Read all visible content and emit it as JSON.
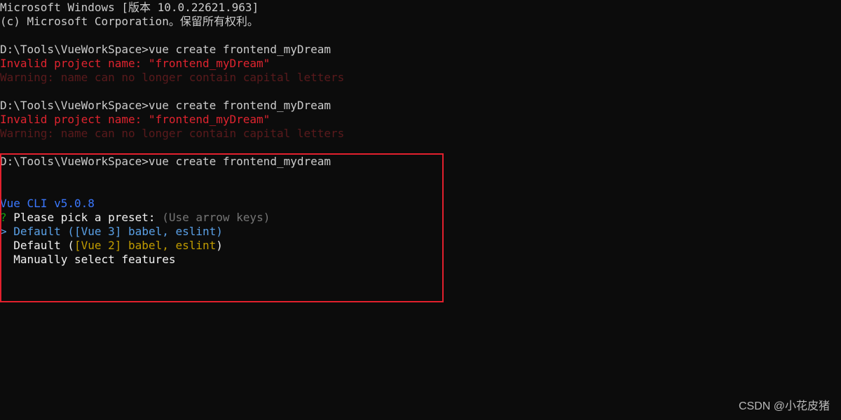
{
  "header": {
    "line1": "Microsoft Windows [版本 10.0.22621.963]",
    "line2": "(c) Microsoft Corporation。保留所有权利。"
  },
  "attempt1": {
    "prompt": "D:\\Tools\\VueWorkSpace>",
    "command": "vue create frontend_myDream",
    "error_label": "Invalid project name: ",
    "error_value": "\"frontend_myDream\"",
    "warning": "Warning: name can no longer contain capital letters"
  },
  "attempt2": {
    "prompt": "D:\\Tools\\VueWorkSpace>",
    "command": "vue create frontend_myDream",
    "error_label": "Invalid project name: ",
    "error_value": "\"frontend_myDream\"",
    "warning": "Warning: name can no longer contain capital letters"
  },
  "attempt3": {
    "prompt": "D:\\Tools\\VueWorkSpace>",
    "command": "vue create frontend_mydream"
  },
  "cli": {
    "version": "Vue CLI v5.0.8",
    "question_mark": "?",
    "question": " Please pick a preset: ",
    "hint": "(Use arrow keys)",
    "pointer": ">",
    "options": [
      {
        "name": "Default",
        "open": " (",
        "bracket": "[Vue 3] babel, eslint",
        "close": ")"
      },
      {
        "name": "Default",
        "open": " (",
        "bracket": "[Vue 2] babel, eslint",
        "close": ")"
      },
      {
        "name": "Manually select features"
      }
    ]
  },
  "watermark": "CSDN @小花皮猪",
  "colors": {
    "background": "#0c0c0c",
    "text": "#cccccc",
    "error": "#e0242f",
    "highlight_box": "#e3202d",
    "cli_blue": "#3b78ff"
  }
}
